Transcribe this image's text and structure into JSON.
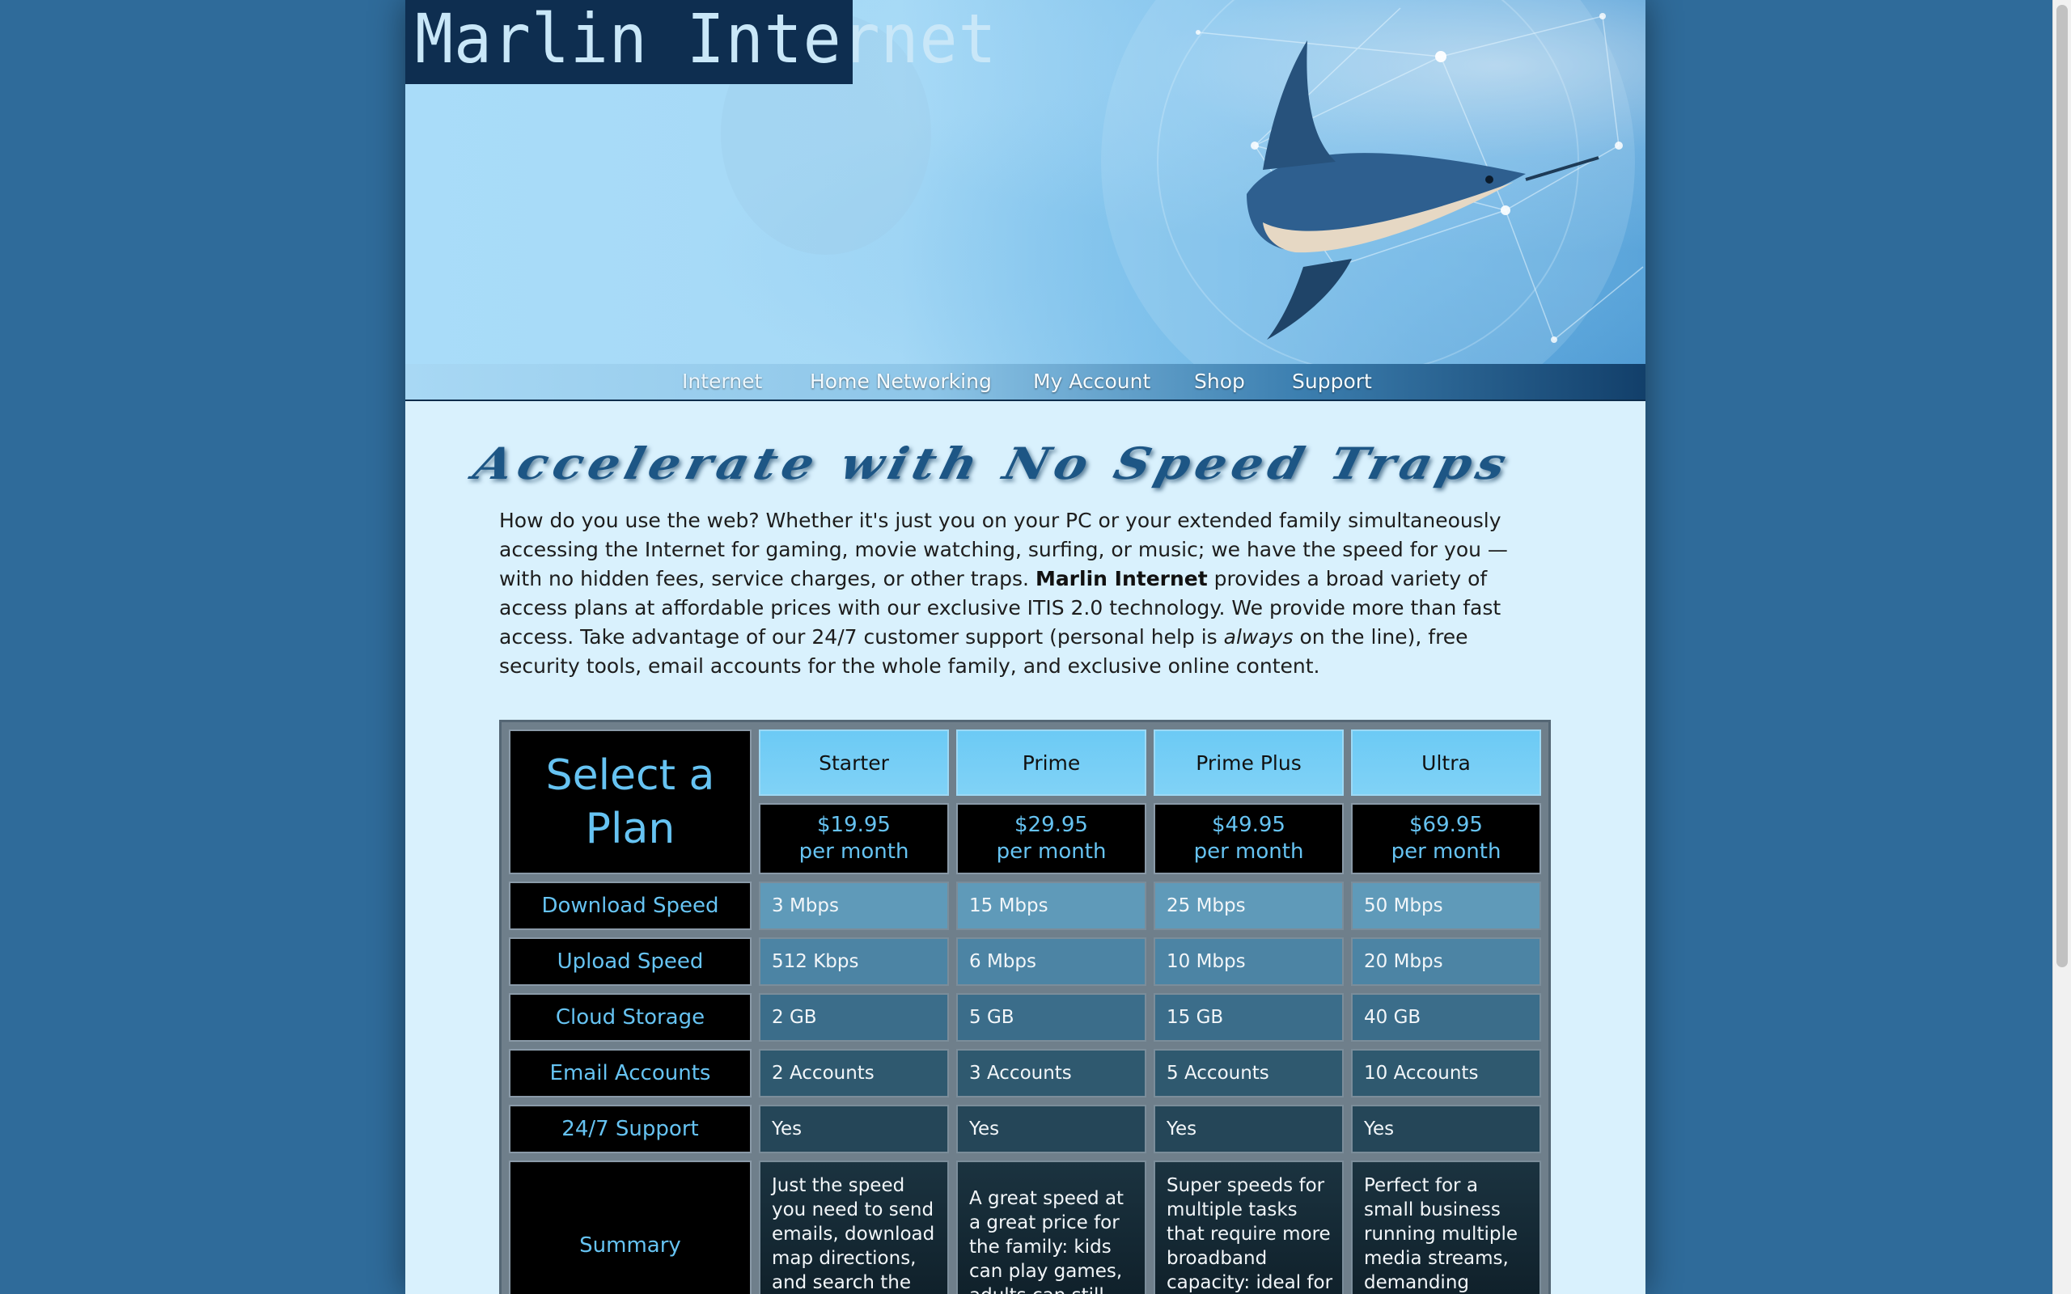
{
  "site": {
    "logo_text": "Marlin Internet"
  },
  "nav": {
    "items": [
      {
        "label": "Internet",
        "active": true
      },
      {
        "label": "Home Networking"
      },
      {
        "label": "My Account"
      },
      {
        "label": "Shop"
      },
      {
        "label": "Support"
      }
    ]
  },
  "main": {
    "headline": "Accelerate with No Speed Traps",
    "intro": {
      "part1": "How do you use the web? Whether it's just you on your PC or your extended family simultaneously accessing the Internet for gaming, movie watching, surfing, or music; we have the speed for you — with no hidden fees, service charges, or other traps. ",
      "brand": "Marlin Internet",
      "part2": " provides a broad variety of access plans at affordable prices with our exclusive ITIS 2.0 technology. We provide more than fast access. Take advantage of our 24/7 customer support (personal help is ",
      "emphasis": "always",
      "part3": " on the line), free security tools, email accounts for the whole family, and exclusive online content."
    }
  },
  "plans": {
    "title": "Select a Plan",
    "columns": [
      {
        "name": "Starter",
        "price": "$19.95",
        "period": "per month"
      },
      {
        "name": "Prime",
        "price": "$29.95",
        "period": "per month"
      },
      {
        "name": "Prime Plus",
        "price": "$49.95",
        "period": "per month"
      },
      {
        "name": "Ultra",
        "price": "$69.95",
        "period": "per month"
      }
    ],
    "rows": [
      {
        "label": "Download Speed",
        "values": [
          "3 Mbps",
          "15 Mbps",
          "25 Mbps",
          "50 Mbps"
        ]
      },
      {
        "label": "Upload Speed",
        "values": [
          "512 Kbps",
          "6 Mbps",
          "10 Mbps",
          "20 Mbps"
        ]
      },
      {
        "label": "Cloud Storage",
        "values": [
          "2 GB",
          "5 GB",
          "15 GB",
          "40 GB"
        ]
      },
      {
        "label": "Email Accounts",
        "values": [
          "2 Accounts",
          "3 Accounts",
          "5 Accounts",
          "10 Accounts"
        ]
      },
      {
        "label": "24/7 Support",
        "values": [
          "Yes",
          "Yes",
          "Yes",
          "Yes"
        ]
      }
    ],
    "summary": {
      "label": "Summary",
      "values": [
        "Just the speed you need to send emails, download map directions, and search the",
        "A great speed at a great price for the family: kids can play games, adults can still",
        "Super speeds for multiple tasks that require more broadband capacity: ideal for",
        "Perfect for a small business running multiple media streams, demanding"
      ]
    }
  },
  "colors": {
    "background": "#2f6b9a",
    "page": "#d9f1fd",
    "accent": "#66c3f2",
    "headline": "#1d5685",
    "logo_bg": "#0e2e50"
  }
}
